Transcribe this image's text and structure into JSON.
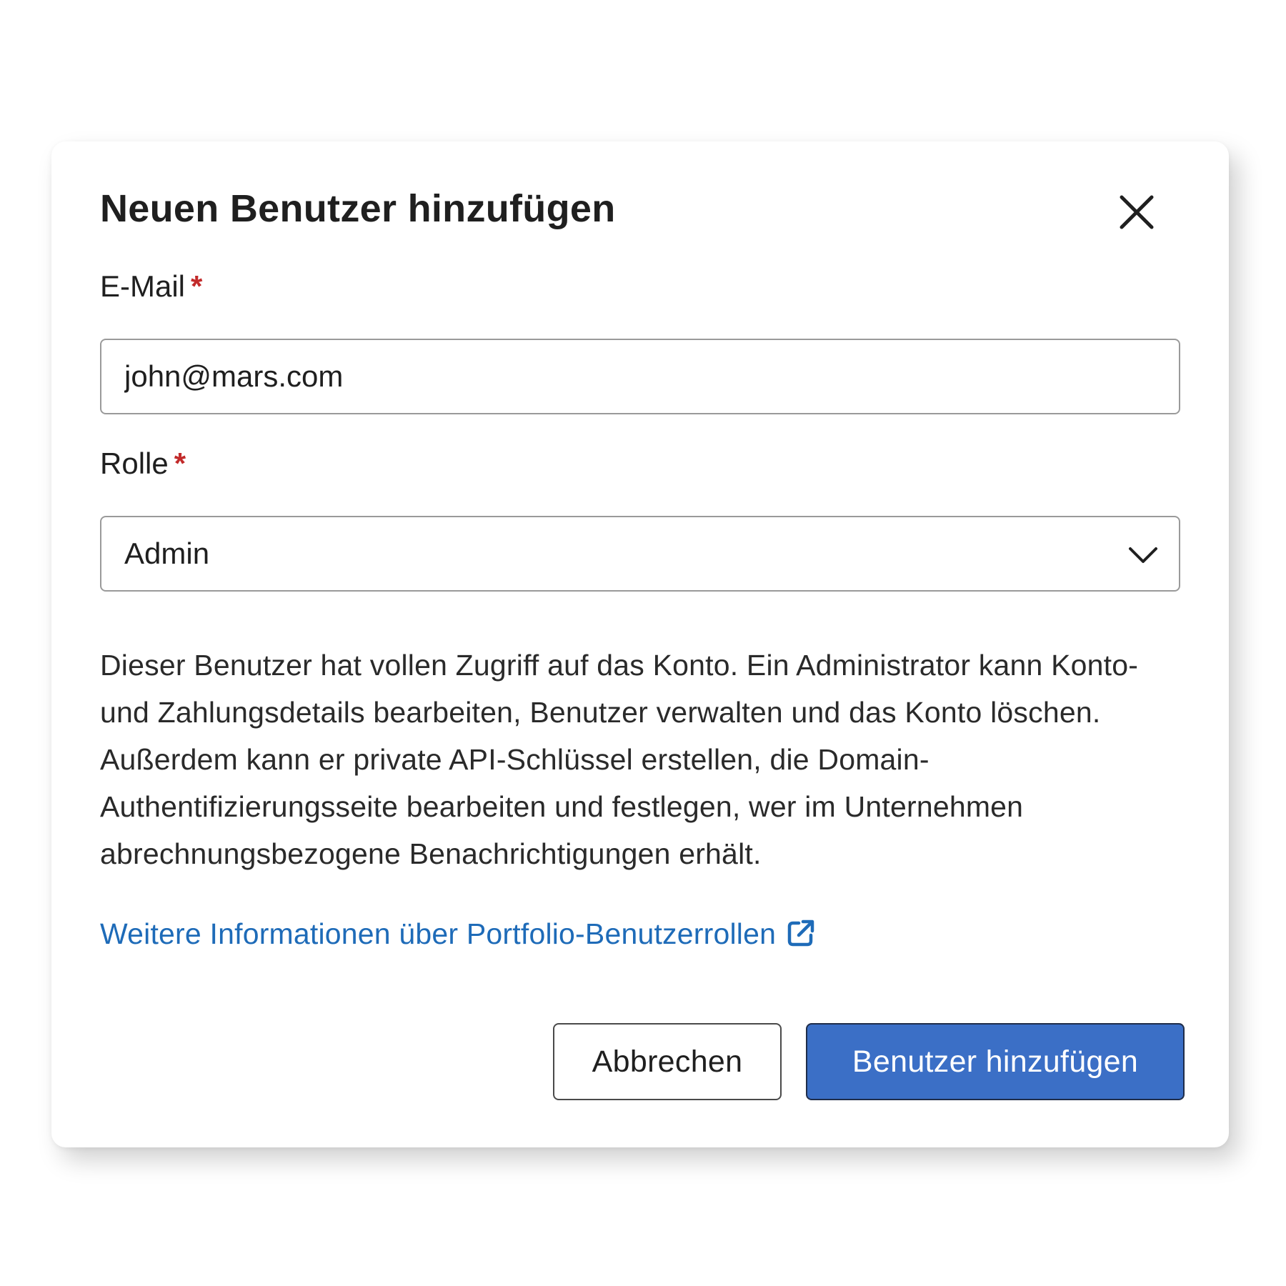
{
  "dialog": {
    "title": "Neuen Benutzer hinzufügen",
    "close_icon": "close-icon"
  },
  "email": {
    "label": "E-Mail",
    "required_marker": "*",
    "value": "john@mars.com"
  },
  "role": {
    "label": "Rolle",
    "required_marker": "*",
    "selected": "Admin",
    "dropdown_icon": "chevron-down-icon"
  },
  "description": "Dieser Benutzer hat vollen Zugriff auf das Konto. Ein Administrator kann Konto- und Zahlungsdetails bearbeiten, Benutzer verwalten und das Konto löschen. Außerdem kann er private API-Schlüssel erstellen, die Domain-Authentifizierungsseite bearbeiten und festlegen, wer im Unternehmen abrechnungsbezogene Benachrichtigungen erhält.",
  "info_link": {
    "label": "Weitere Informationen über Portfolio-Benutzerrollen",
    "icon": "external-link-icon"
  },
  "buttons": {
    "cancel": "Abbrechen",
    "submit": "Benutzer hinzufügen"
  },
  "colors": {
    "required": "#c22a2a",
    "link": "#1e6bb8",
    "primary_button": "#3b6fc6"
  }
}
